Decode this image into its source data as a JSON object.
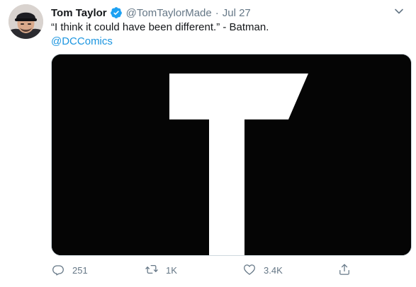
{
  "tweet": {
    "author_name": "Tom Taylor",
    "handle": "@TomTaylorMade",
    "separator": "·",
    "date": "Jul 27",
    "text": "“I think it could have been different.” - Batman.",
    "mention": "@DCComics",
    "media": {
      "glyph": "T",
      "background": "#050505",
      "glyph_color": "#ffffff"
    }
  },
  "actions": {
    "replies": "251",
    "retweets": "1K",
    "likes": "3.4K"
  },
  "icons": {
    "verified": "verified-badge-icon",
    "more": "chevron-down-icon",
    "reply": "reply-icon",
    "retweet": "retweet-icon",
    "like": "heart-icon",
    "share": "share-icon"
  },
  "colors": {
    "accent": "#1da1f2",
    "link": "#1b95e0",
    "secondary_text": "#657786"
  }
}
